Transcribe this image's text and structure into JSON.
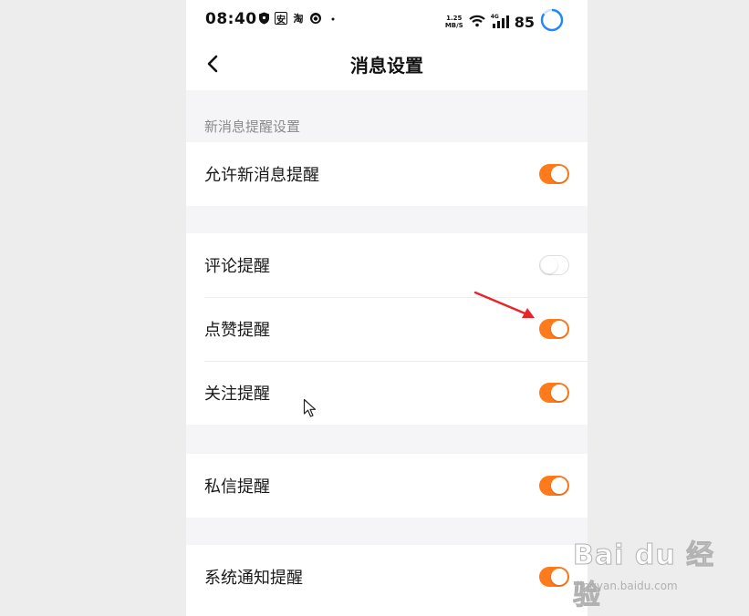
{
  "status_bar": {
    "time": "08:40",
    "left_icons": [
      "shield-icon",
      "app-icon-an",
      "taobao-icon",
      "app-icon-round",
      "dot-icon"
    ],
    "taobao_glyph": "淘",
    "an_glyph": "安",
    "speed_value": "1.25",
    "speed_unit": "MB/S",
    "network": "4G",
    "battery": "85",
    "right_icons": [
      "wifi-icon",
      "signal-icon",
      "battery-ring-icon"
    ]
  },
  "nav": {
    "title": "消息设置",
    "back_icon": "chevron-left-icon"
  },
  "sections": {
    "new_message_title": "新消息提醒设置"
  },
  "groups": [
    {
      "items": [
        {
          "label": "允许新消息提醒",
          "enabled": true
        }
      ]
    },
    {
      "items": [
        {
          "label": "评论提醒",
          "enabled": false
        },
        {
          "label": "点赞提醒",
          "enabled": true
        },
        {
          "label": "关注提醒",
          "enabled": true
        }
      ]
    },
    {
      "items": [
        {
          "label": "私信提醒",
          "enabled": true
        }
      ]
    },
    {
      "items": [
        {
          "label": "系统通知提醒",
          "enabled": true
        }
      ]
    }
  ],
  "colors": {
    "toggle_on": "#ff7a1a",
    "toggle_off": "#ffffff",
    "annotation_arrow": "#e8252b",
    "page_bg": "#f5f5f7"
  },
  "watermark": {
    "brand": "Bai du 经验",
    "url": "jingyan.baidu.com"
  }
}
